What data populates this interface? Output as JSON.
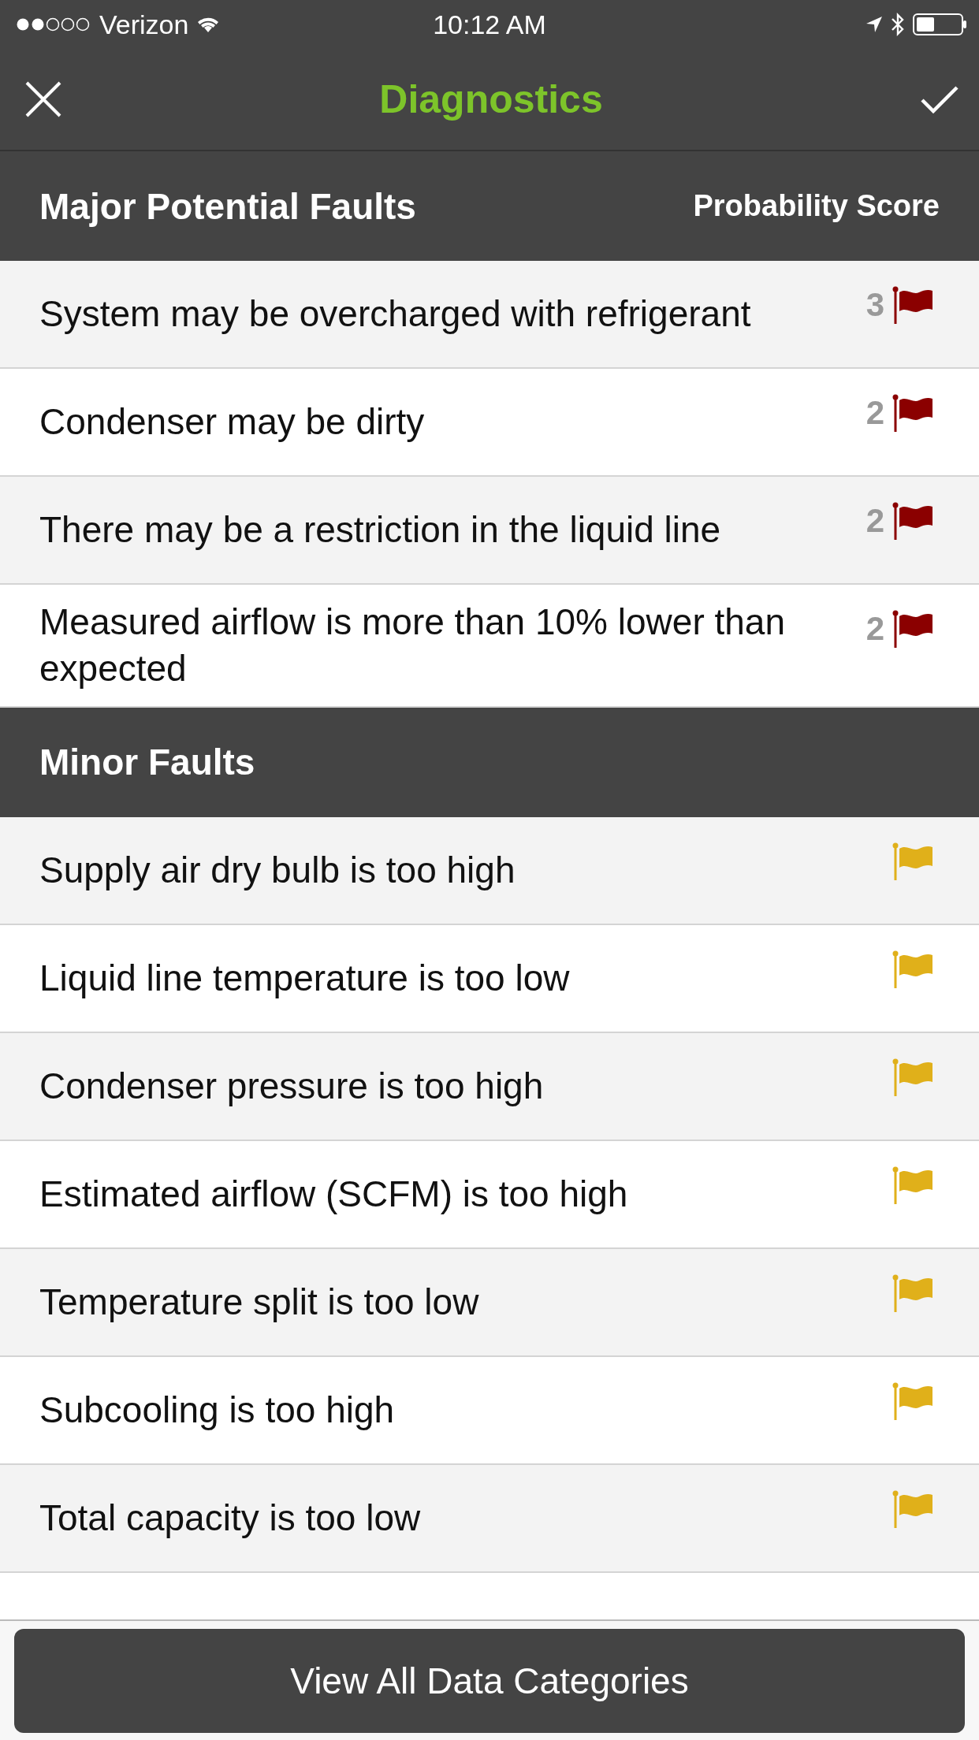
{
  "status_bar": {
    "carrier": "Verizon",
    "time": "10:12 AM"
  },
  "nav": {
    "title": "Diagnostics"
  },
  "sections": [
    {
      "kind": "major",
      "title": "Major Potential Faults",
      "column_label": "Probability Score",
      "rows": [
        {
          "text": "System may be overcharged with refrigerant",
          "score": "3"
        },
        {
          "text": "Condenser may be dirty",
          "score": "2"
        },
        {
          "text": "There may be a restriction in the liquid line",
          "score": "2"
        },
        {
          "text": "Measured airflow is more than 10% lower than expected",
          "score": "2"
        }
      ]
    },
    {
      "kind": "minor",
      "title": "Minor Faults",
      "rows": [
        {
          "text": "Supply air dry bulb is too high"
        },
        {
          "text": "Liquid line temperature is too low"
        },
        {
          "text": "Condenser pressure is too high"
        },
        {
          "text": "Estimated airflow (SCFM) is too high"
        },
        {
          "text": "Temperature split is too low"
        },
        {
          "text": "Subcooling is too high"
        },
        {
          "text": "Total capacity is too low"
        }
      ]
    }
  ],
  "footer_button": "View All Data Categories"
}
